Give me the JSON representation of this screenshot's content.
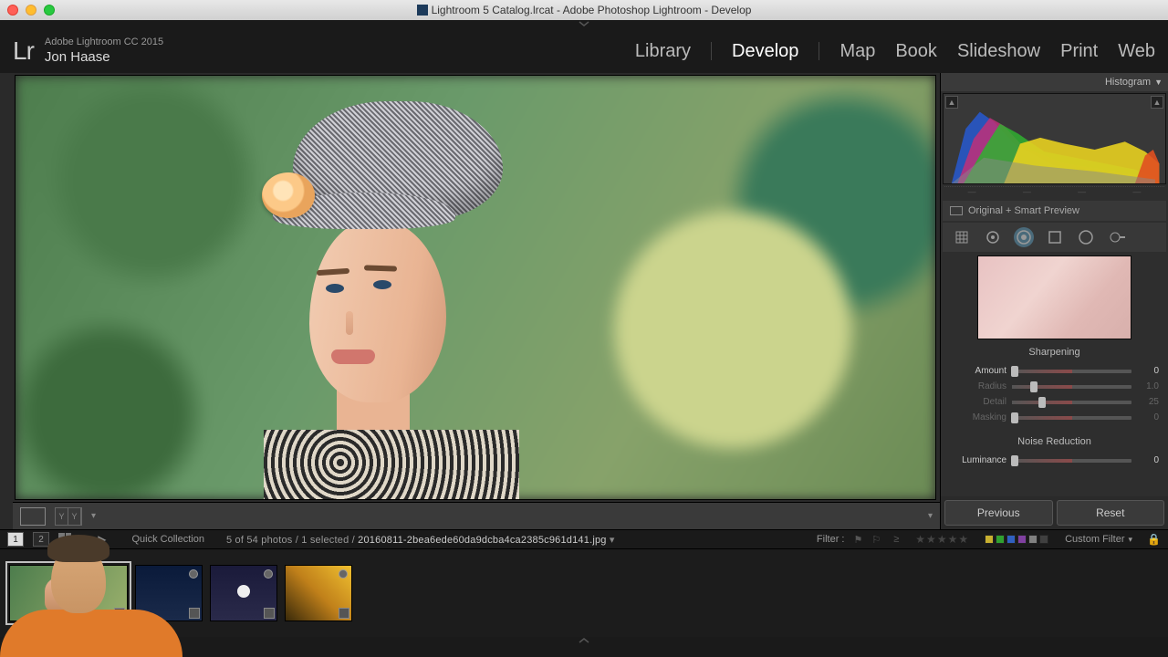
{
  "window": {
    "title": "Lightroom 5 Catalog.lrcat - Adobe Photoshop Lightroom - Develop"
  },
  "header": {
    "app_line": "Adobe Lightroom CC 2015",
    "identity": "Jon Haase",
    "logo_text": "Lr",
    "modules": [
      "Library",
      "Develop",
      "Map",
      "Book",
      "Slideshow",
      "Print",
      "Web"
    ],
    "active_module": "Develop"
  },
  "right": {
    "histogram_label": "Histogram",
    "preview_type": "Original + Smart Preview",
    "sharpening": {
      "title": "Sharpening",
      "rows": [
        {
          "label": "Amount",
          "value": "0",
          "pos": 2,
          "dim": false
        },
        {
          "label": "Radius",
          "value": "1.0",
          "pos": 18,
          "dim": true
        },
        {
          "label": "Detail",
          "value": "25",
          "pos": 25,
          "dim": true
        },
        {
          "label": "Masking",
          "value": "0",
          "pos": 2,
          "dim": true
        }
      ]
    },
    "noise": {
      "title": "Noise Reduction",
      "rows": [
        {
          "label": "Luminance",
          "value": "0",
          "pos": 2,
          "dim": false
        }
      ]
    },
    "buttons": {
      "prev": "Previous",
      "reset": "Reset"
    }
  },
  "filterbar": {
    "pages": [
      "1",
      "2"
    ],
    "active_page": "1",
    "source": "Quick Collection",
    "counts": "5 of 54 photos / 1 selected /",
    "filename": "20160811-2bea6ede60da9dcba4ca2385c961d141.jpg",
    "filter_label": "Filter :",
    "custom_filter": "Custom Filter",
    "color_labels": [
      "#c8b030",
      "#30a030",
      "#3060c0",
      "#8040a0",
      "#808080",
      "#404040"
    ]
  },
  "toolstrip_icons": [
    "crop-tool",
    "spot-removal-tool",
    "redeye-tool",
    "graduated-filter-tool",
    "radial-filter-tool",
    "adjustment-brush-tool"
  ]
}
